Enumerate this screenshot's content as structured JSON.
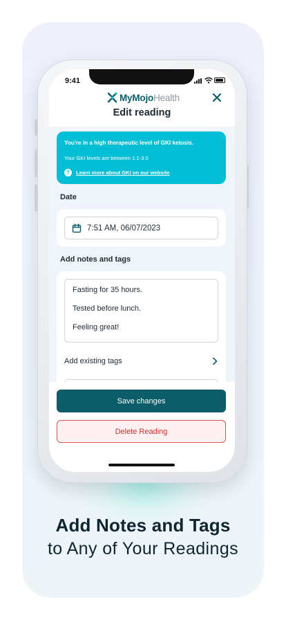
{
  "status_bar": {
    "time": "9:41"
  },
  "app": {
    "logo_my": "My",
    "logo_mojo": "Mojo",
    "logo_health": "Health",
    "title": "Edit reading"
  },
  "banner": {
    "title": "You're in a high therapeutic level of GKI ketosis.",
    "subtitle": "Your GKI levels are between 1.1-3.0",
    "link": "Learn more about GKI on our website",
    "help_icon_glyph": "?"
  },
  "date_section": {
    "label": "Date",
    "value": "7:51 AM, 06/07/2023"
  },
  "notes_section": {
    "label": "Add notes and tags",
    "lines": [
      "Fasting for 35 hours.",
      "Tested before lunch.",
      "Feeling great!"
    ],
    "tags_label": "Add existing tags"
  },
  "actions": {
    "save": "Save changes",
    "delete": "Delete Reading"
  },
  "marketing": {
    "headline": "Add Notes and Tags",
    "subline": "to Any of Your Readings"
  },
  "colors": {
    "brand_teal": "#0c5c69",
    "banner_cyan": "#03bed4",
    "delete_red": "#c8302c",
    "logo_gray": "#8d98a3"
  },
  "icons": [
    "logo-icon",
    "close-icon",
    "help-icon",
    "calendar-icon",
    "chevron-right-icon",
    "signal-icon",
    "wifi-icon",
    "battery-icon"
  ]
}
